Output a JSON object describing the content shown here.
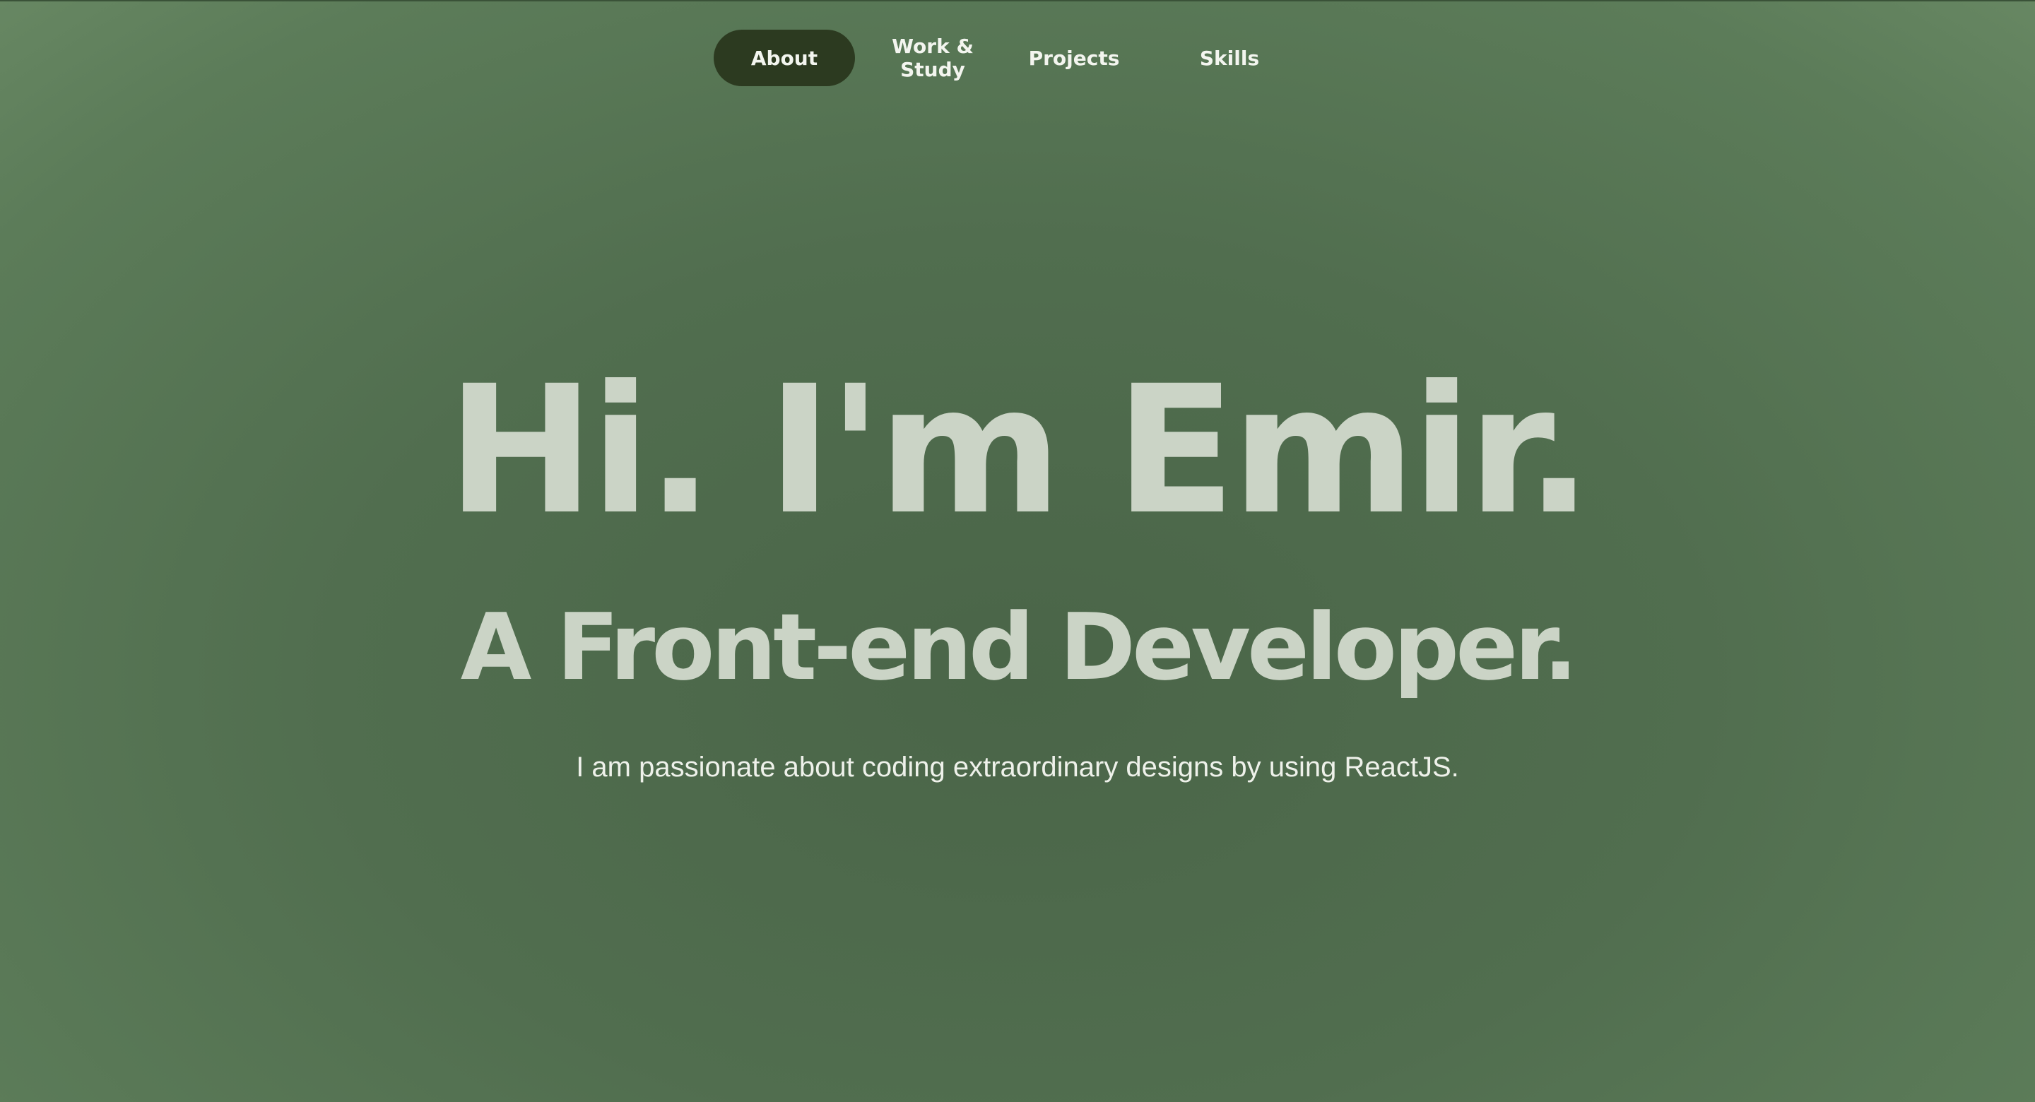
{
  "nav": {
    "items": [
      {
        "label": "About",
        "active": true
      },
      {
        "label_line1": "Work &",
        "label_line2": "Study",
        "active": false
      },
      {
        "label": "Projects",
        "active": false
      },
      {
        "label": "Skills",
        "active": false
      }
    ]
  },
  "hero": {
    "title": "Hi. I'm Emir.",
    "subtitle": "A Front-end Developer.",
    "tagline": "I am passionate about coding extraordinary designs by using ReactJS."
  },
  "colors": {
    "background": "#516e4f",
    "active_pill": "#2c3a20",
    "heading_text": "#cbd4c6",
    "body_text": "#eef1ea"
  }
}
